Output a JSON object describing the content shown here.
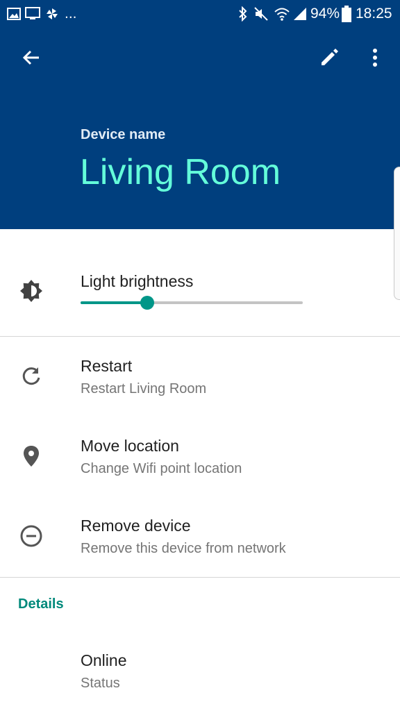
{
  "status_bar": {
    "battery": "94%",
    "time": "18:25",
    "overflow": "..."
  },
  "header": {
    "label": "Device name",
    "device_name": "Living Room"
  },
  "brightness": {
    "title": "Light brightness",
    "level": 0.3
  },
  "actions": [
    {
      "title": "Restart",
      "subtitle": "Restart Living Room"
    },
    {
      "title": "Move location",
      "subtitle": "Change Wifi point location"
    },
    {
      "title": "Remove device",
      "subtitle": "Remove this device from network"
    }
  ],
  "details": {
    "heading": "Details",
    "status_value": "Online",
    "status_label": "Status"
  },
  "colors": {
    "header_bg": "#003f7e",
    "accent": "#64ffda",
    "teal": "#009688"
  }
}
